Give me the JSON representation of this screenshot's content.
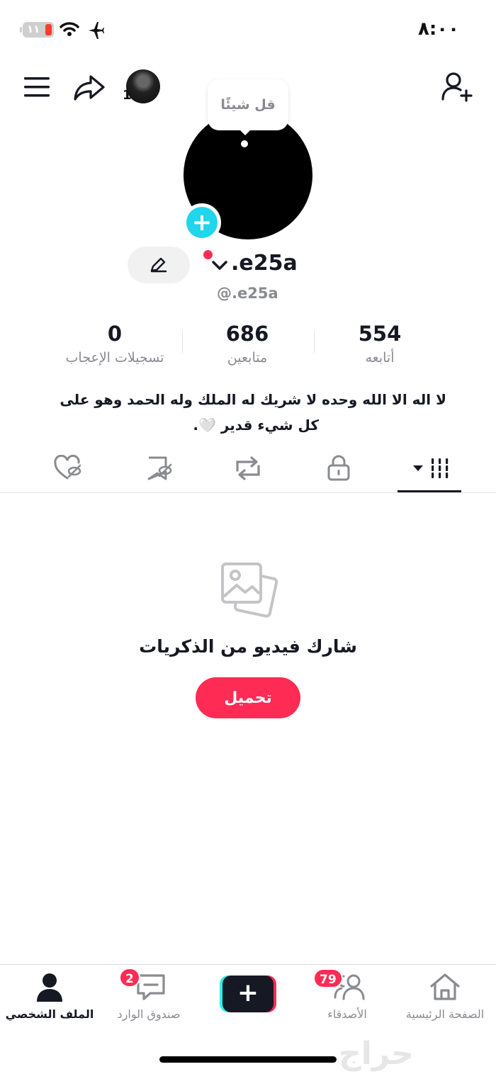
{
  "status_bar": {
    "time": "٨:٠٠",
    "battery_level": "١١",
    "battery_color": "#ff3b30"
  },
  "top_bar": {
    "menu_icon": "hamburger-menu-icon",
    "share_icon": "share-arrow-icon",
    "story_count": "1",
    "add_user_icon": "add-user-icon"
  },
  "profile": {
    "speech_bubble": "قل شيئًا",
    "display_name": ".e25a",
    "username": "@.e25a",
    "bio_line1": "لا اله الا الله وحده لا شريك له الملك وله الحمد وهو على",
    "bio_line2": "كل شيء قدير 🤍."
  },
  "stats": [
    {
      "value": "554",
      "label": "أتابعه"
    },
    {
      "value": "686",
      "label": "متابعين"
    },
    {
      "value": "0",
      "label": "تسجيلات الإعجاب"
    }
  ],
  "tabs": [
    {
      "icon": "videos-grid-icon",
      "active": true
    },
    {
      "icon": "lock-icon",
      "active": false
    },
    {
      "icon": "repost-icon",
      "active": false
    },
    {
      "icon": "favorites-hidden-icon",
      "active": false
    },
    {
      "icon": "liked-hidden-icon",
      "active": false
    }
  ],
  "empty_state": {
    "icon": "photos-icon",
    "title": "شارك فيديو من الذكريات",
    "button": "تحميل"
  },
  "bottom_nav": {
    "home": "الصفحة الرئيسية",
    "friends": "الأصدقاء",
    "friends_badge": "79",
    "create": "+",
    "inbox": "صندوق الوارد",
    "inbox_badge": "2",
    "profile": "الملف الشخصي"
  },
  "colors": {
    "accent": "#fe2c55",
    "cyan": "#20d5ec",
    "text": "#161823",
    "muted": "#8a8b91"
  },
  "watermark": "حراج"
}
